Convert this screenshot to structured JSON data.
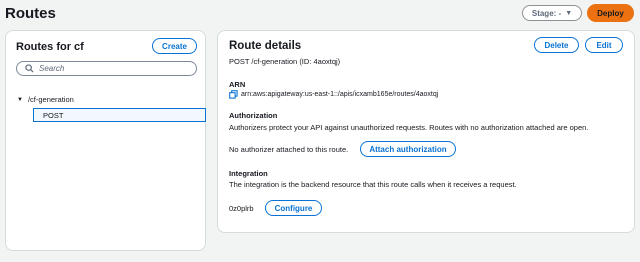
{
  "header": {
    "title": "Routes",
    "stage_select": "Stage: -",
    "deploy_label": "Deploy"
  },
  "left_panel": {
    "title": "Routes for cf",
    "create_label": "Create",
    "search_placeholder": "Search",
    "tree": {
      "resource": "/cf-generation",
      "method": "POST"
    }
  },
  "details": {
    "title": "Route details",
    "delete_label": "Delete",
    "edit_label": "Edit",
    "subtitle": "POST /cf-generation (ID: 4aoxtqj)",
    "arn_label": "ARN",
    "arn_value": "arn:aws:apigateway:us-east-1::/apis/icxamb165e/routes/4aoxtqj",
    "authorization_label": "Authorization",
    "authorization_desc": "Authorizers protect your API against unauthorized requests. Routes with no authorization attached are open.",
    "authorization_status": "No authorizer attached to this route.",
    "attach_label": "Attach authorization",
    "integration_label": "Integration",
    "integration_desc": "The integration is the backend resource that this route calls when it receives a request.",
    "integration_id": "0z0plrb",
    "configure_label": "Configure"
  },
  "colors": {
    "accent": "#0972d3",
    "deploy": "#ec7211",
    "background": "#f2f3f3"
  },
  "icons": [
    "search-icon",
    "copy-icon",
    "caret-down-icon",
    "tree-expand-icon"
  ]
}
